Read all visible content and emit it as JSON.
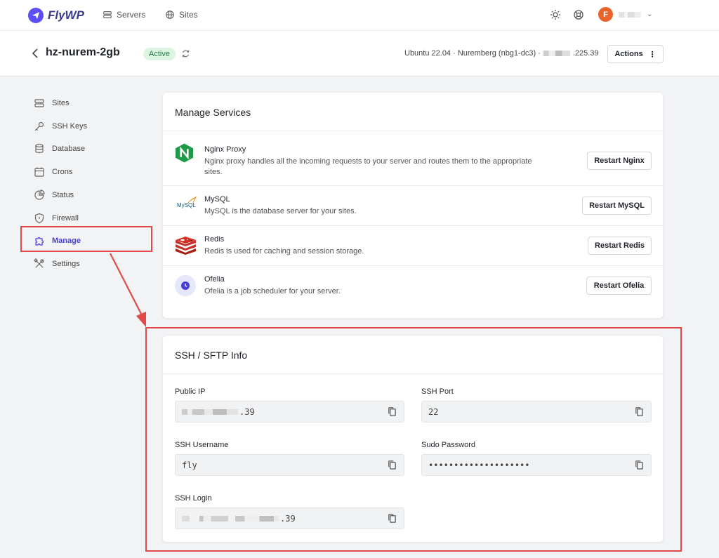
{
  "nav": {
    "brand": "FlyWP",
    "servers_label": "Servers",
    "sites_label": "Sites",
    "avatar_initial": "F"
  },
  "server": {
    "name": "hz-nurem-2gb",
    "status": "Active",
    "meta_text": "Ubuntu 22.04 · Nuremberg (nbg1-dc3) ·",
    "ip_suffix": ".225.39",
    "actions_label": "Actions"
  },
  "sidebar": {
    "items": [
      {
        "label": "Sites",
        "icon": "sites-icon"
      },
      {
        "label": "SSH Keys",
        "icon": "key-icon"
      },
      {
        "label": "Database",
        "icon": "database-icon"
      },
      {
        "label": "Crons",
        "icon": "calendar-icon"
      },
      {
        "label": "Status",
        "icon": "pie-chart-icon"
      },
      {
        "label": "Firewall",
        "icon": "shield-icon"
      },
      {
        "label": "Manage",
        "icon": "puzzle-icon"
      },
      {
        "label": "Settings",
        "icon": "tools-icon"
      }
    ],
    "active": "Manage"
  },
  "services": {
    "title": "Manage Services",
    "items": [
      {
        "name": "Nginx Proxy",
        "description": "Nginx proxy handles all the incoming requests to your server and routes them to the appropriate sites.",
        "button": "Restart Nginx"
      },
      {
        "name": "MySQL",
        "description": "MySQL is the database server for your sites.",
        "button": "Restart MySQL",
        "logo_text": "MySQL"
      },
      {
        "name": "Redis",
        "description": "Redis is used for caching and session storage.",
        "button": "Restart Redis"
      },
      {
        "name": "Ofelia",
        "description": "Ofelia is a job scheduler for your server.",
        "button": "Restart Ofelia"
      }
    ]
  },
  "ssh": {
    "title": "SSH / SFTP Info",
    "public_ip": {
      "label": "Public IP",
      "value_suffix": ".39"
    },
    "ssh_port": {
      "label": "SSH Port",
      "value": "22"
    },
    "ssh_username": {
      "label": "SSH Username",
      "value": "fly"
    },
    "sudo_password": {
      "label": "Sudo Password",
      "value": "••••••••••••••••••••"
    },
    "ssh_login": {
      "label": "SSH Login",
      "value_suffix": ".39"
    }
  },
  "colors": {
    "accent": "#4a3fd6",
    "annotation_red": "#e04a4a",
    "active_badge_bg": "#dcf5e3",
    "active_badge_text": "#2a7a45",
    "avatar": "#e8642c"
  }
}
